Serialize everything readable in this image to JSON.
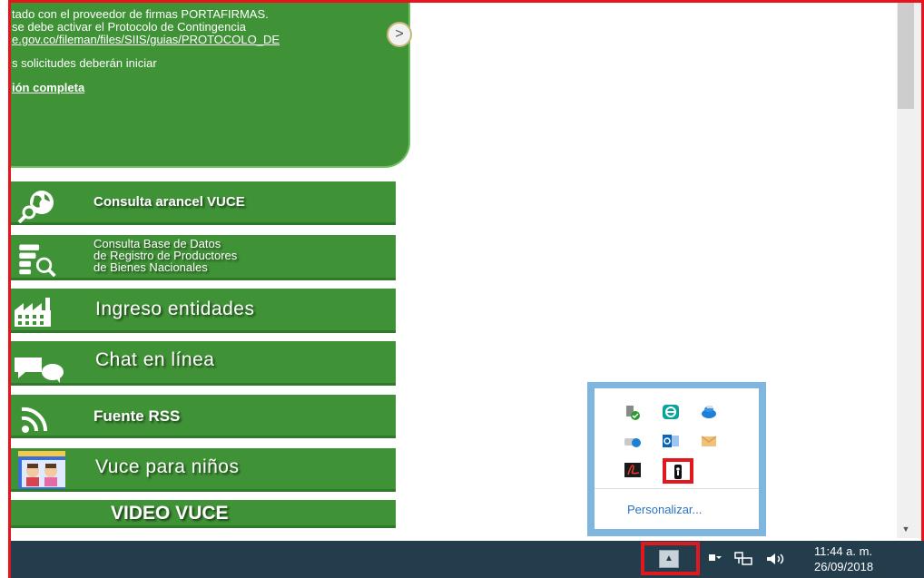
{
  "notice": {
    "line1": "tado con el proveedor de firmas PORTAFIRMAS.",
    "line2": "se debe activar el Protocolo de Contingencia",
    "line3": "e.gov.co/fileman/files/SIIS/guias/PROTOCOLO_DE",
    "line4": "s solicitudes deberán iniciar",
    "link": "ión completa",
    "next_label": ">"
  },
  "menu": [
    {
      "label": "Consulta arancel VUCE",
      "icon": "world-search-icon"
    },
    {
      "label": "Consulta Base de Datos",
      "label2": "de Registro de Productores",
      "label3": "de Bienes Nacionales",
      "icon": "database-search-icon"
    },
    {
      "label": "Ingreso entidades",
      "icon": "factory-icon"
    },
    {
      "label": "Chat en línea",
      "icon": "chat-bubbles-icon"
    },
    {
      "label": "Fuente RSS",
      "icon": "rss-icon"
    },
    {
      "label": "Vuce para niños",
      "icon": "kids-icon"
    },
    {
      "label": "VIDEO VUCE"
    }
  ],
  "tray_popup": {
    "icons": [
      "usb-safe-remove-icon",
      "eset-icon",
      "dropbox-like-icon",
      "network-drive-icon",
      "outlook-icon",
      "mail-icon",
      "adobe-acrobat-icon",
      "security-token-icon"
    ],
    "customize_label": "Personalizar..."
  },
  "taskbar": {
    "chevron_label": "▲",
    "time": "11:44 a. m.",
    "date": "26/09/2018",
    "icons": [
      "flag-icon",
      "network-icon",
      "volume-icon"
    ]
  },
  "colors": {
    "accent_green": "#3f9236",
    "highlight_red": "#e0191f",
    "taskbar": "#243d4d",
    "popup_border": "#7fb6e0"
  }
}
